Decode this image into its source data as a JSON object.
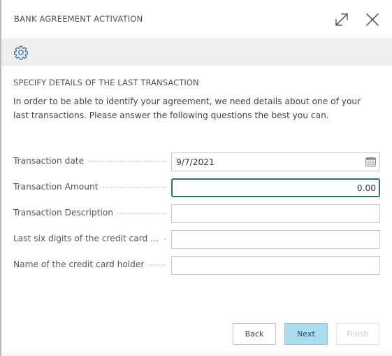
{
  "dialog": {
    "title": "BANK AGREEMENT ACTIVATION",
    "expand_icon": "expand-diagonal-arrow-icon",
    "close_icon": "close-x-icon"
  },
  "actionbar": {
    "settings_icon": "gear-icon"
  },
  "content": {
    "section_title": "SPECIFY DETAILS OF THE LAST TRANSACTION",
    "instructions": "In order to be able to identify your agreement, we need details about one of your last transactions. Please answer the following questions the best you can.",
    "fields": [
      {
        "label": "Transaction date",
        "value": "9/7/2021",
        "icon": "calendar-icon"
      },
      {
        "label": "Transaction Amount",
        "value": "0.00",
        "focused": true
      },
      {
        "label": "Transaction Description",
        "value": ""
      },
      {
        "label": "Last six digits of the credit card ...",
        "value": ""
      },
      {
        "label": "Name of the credit card holder",
        "value": ""
      }
    ]
  },
  "footer": {
    "back_label": "Back",
    "next_label": "Next",
    "finish_label": "Finish",
    "finish_disabled": true,
    "accent_color": "#a8def0"
  }
}
